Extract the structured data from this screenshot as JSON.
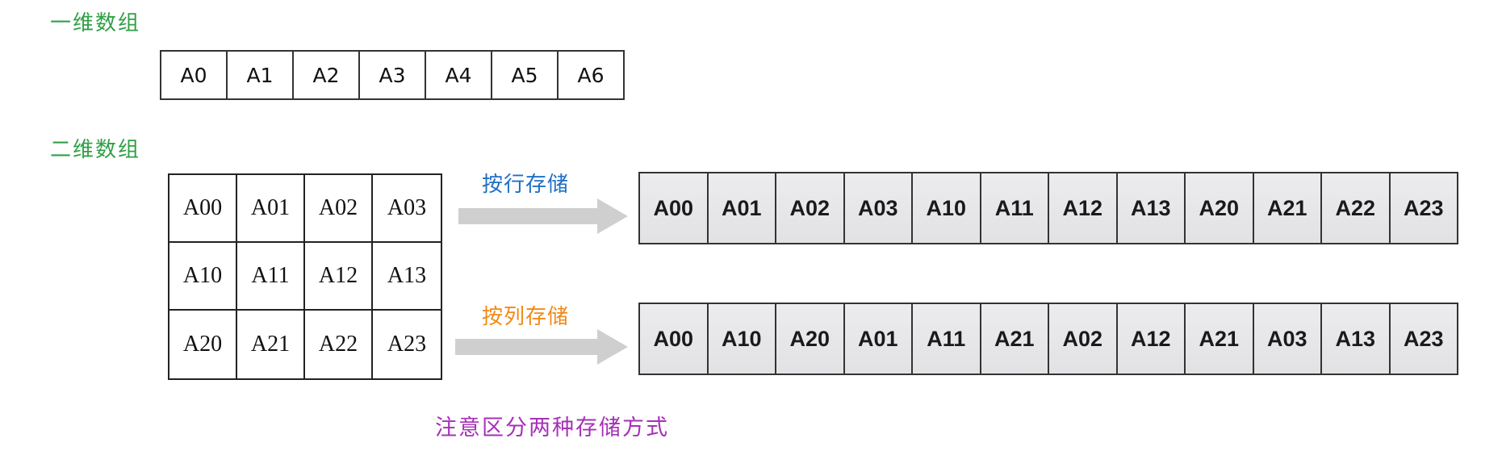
{
  "heading_1d": "一维数组",
  "heading_2d": "二维数组",
  "array_1d": [
    "A0",
    "A1",
    "A2",
    "A3",
    "A4",
    "A5",
    "A6"
  ],
  "matrix_2d": [
    [
      "A00",
      "A01",
      "A02",
      "A03"
    ],
    [
      "A10",
      "A11",
      "A12",
      "A13"
    ],
    [
      "A20",
      "A21",
      "A22",
      "A23"
    ]
  ],
  "row_major": {
    "label": "按行存储",
    "color": "#1f6fc4",
    "cells": [
      "A00",
      "A01",
      "A02",
      "A03",
      "A10",
      "A11",
      "A12",
      "A13",
      "A20",
      "A21",
      "A22",
      "A23"
    ]
  },
  "column_major": {
    "label": "按列存储",
    "color": "#f08a1a",
    "cells": [
      "A00",
      "A10",
      "A20",
      "A01",
      "A11",
      "A21",
      "A02",
      "A12",
      "A21",
      "A03",
      "A13",
      "A23"
    ]
  },
  "note": "注意区分两种存储方式",
  "colors": {
    "heading": "#2fa046",
    "note": "#a630b8",
    "arrow": "#cfcfcf",
    "linear_fill": "#e7e7e9"
  },
  "icons": {
    "arrow": "right-arrow-icon"
  }
}
